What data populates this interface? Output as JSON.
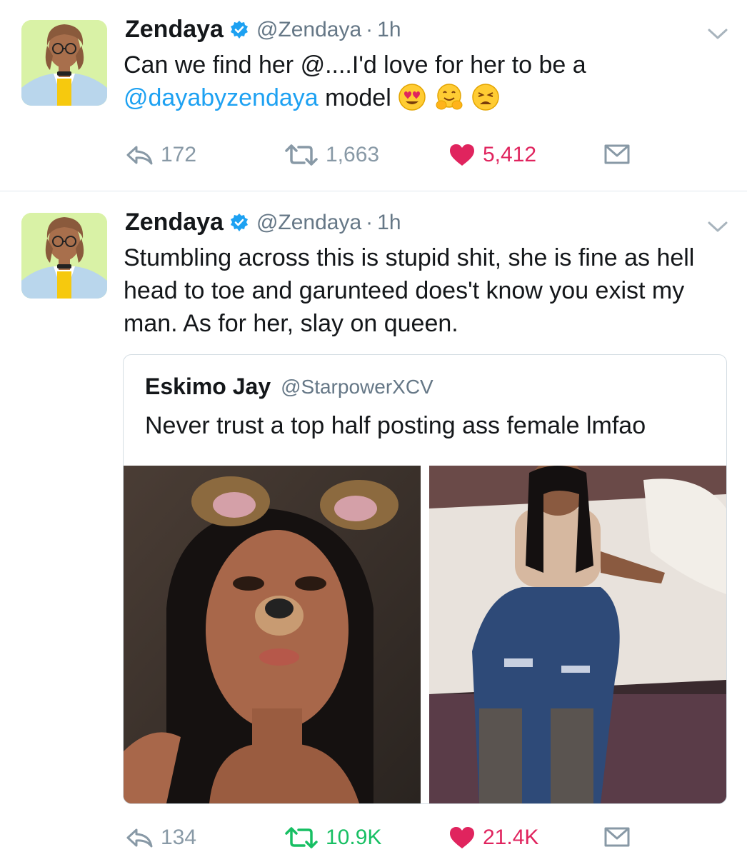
{
  "tweets": [
    {
      "author_name": "Zendaya",
      "handle": "@Zendaya",
      "separator": "·",
      "time": "1h",
      "text_line1": "Can we find her @....I'd love for her to be a",
      "mention": "@dayabyzendaya",
      "text_after_mention": " model",
      "emojis": [
        "heart-eyes-emoji",
        "hugging-emoji",
        "weary-emoji"
      ],
      "replies": "172",
      "retweets": "1,663",
      "likes": "5,412"
    },
    {
      "author_name": "Zendaya",
      "handle": "@Zendaya",
      "separator": "·",
      "time": "1h",
      "text": "Stumbling across this is stupid shit, she is fine as hell head to toe and garunteed does't know you exist my man. As for her, slay on queen.",
      "quote": {
        "author_name": "Eskimo Jay",
        "handle": "@StarpowerXCV",
        "text": "Never trust a top half posting ass female lmfao"
      },
      "replies": "134",
      "retweets": "10.9K",
      "likes": "21.4K"
    }
  ],
  "icons": {
    "reply": "reply-icon",
    "retweet": "retweet-icon",
    "like": "heart-icon",
    "dm": "envelope-icon",
    "verified": "verified-badge-icon",
    "menu": "chevron-down-icon"
  },
  "colors": {
    "link": "#1da1f2",
    "retweet_active": "#17bf63",
    "like_active": "#e0245e",
    "muted": "#8899a6"
  }
}
